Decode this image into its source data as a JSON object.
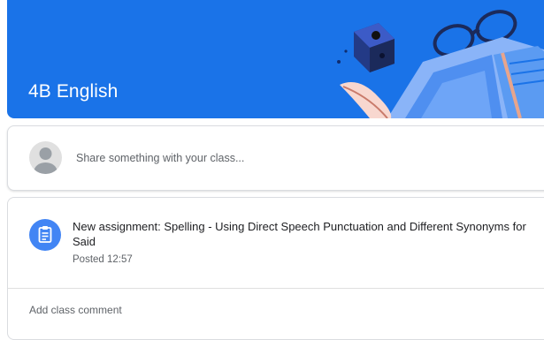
{
  "banner": {
    "class_name": "4B English",
    "color": "#1a73e8"
  },
  "share_box": {
    "placeholder": "Share something with your class..."
  },
  "post": {
    "title": "New assignment: Spelling - Using Direct Speech Punctuation and Different Synonyms for Said",
    "posted": "Posted 12:57",
    "icon": "assignment-icon",
    "icon_color": "#4285f4"
  },
  "comment": {
    "label": "Add class comment"
  }
}
